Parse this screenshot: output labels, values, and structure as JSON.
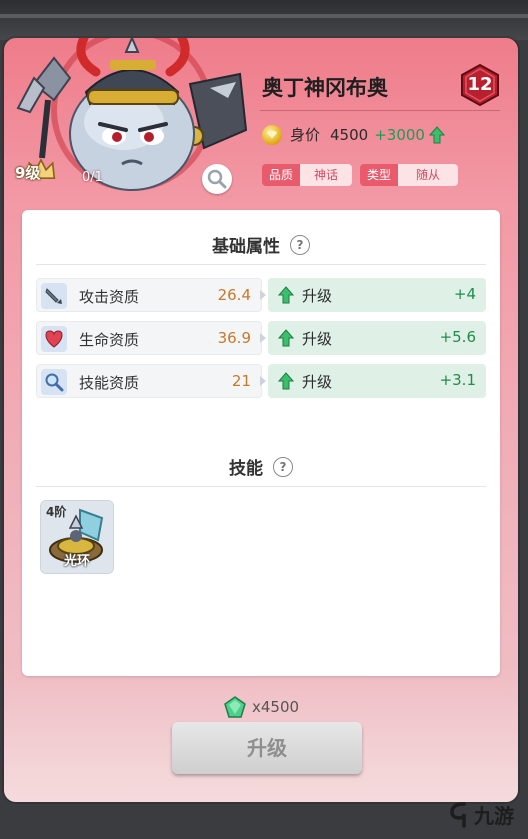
{
  "hero": {
    "name": "奥丁神冈布奥",
    "stars": "12",
    "level": "9级",
    "exp": "0/1"
  },
  "price": {
    "label": "身价",
    "value": "4500",
    "bonus": "+3000"
  },
  "tags": {
    "quality_key": "品质",
    "quality_val": "神话",
    "type_key": "类型",
    "type_val": "随从"
  },
  "attributes": {
    "title": "基础属性",
    "help": "?",
    "upgrade_label": "升级",
    "rows": [
      {
        "name": "攻击资质",
        "value": "26.4",
        "gain": "+4",
        "icon": "sword-icon"
      },
      {
        "name": "生命资质",
        "value": "36.9",
        "gain": "+5.6",
        "icon": "heart-shield-icon"
      },
      {
        "name": "技能资质",
        "value": "21",
        "gain": "+3.1",
        "icon": "magnifier-icon"
      }
    ]
  },
  "skills": {
    "title": "技能",
    "help": "?",
    "items": [
      {
        "tier": "4阶",
        "name": "光环"
      }
    ]
  },
  "upgrade": {
    "cost": "x4500",
    "button_label": "升级"
  },
  "watermark": {
    "text": "九游"
  },
  "colors": {
    "panel_top": "#ef7c8a",
    "tag_key": "#e85a6c",
    "gain_green": "#1f8c4a",
    "attr_value": "#c8782a"
  }
}
